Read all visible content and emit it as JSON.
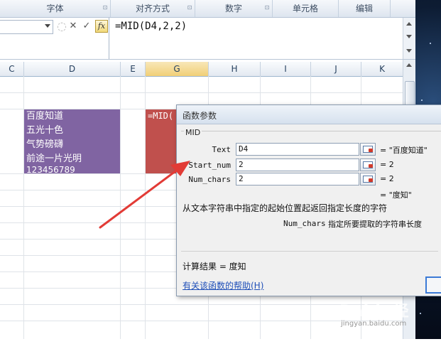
{
  "ribbon": {
    "groups": [
      {
        "label": "字体",
        "launcher": "⊡"
      },
      {
        "label": "对齐方式",
        "launcher": "⊡"
      },
      {
        "label": "数字",
        "launcher": "⊡"
      },
      {
        "label": "单元格"
      },
      {
        "label": "编辑"
      }
    ]
  },
  "formula_bar": {
    "cancel_symbol": "✕",
    "enter_symbol": "✓",
    "fx_label": "fx",
    "formula": "=MID(D4,2,2)"
  },
  "columns": [
    "C",
    "D",
    "E",
    "G",
    "H",
    "I",
    "J",
    "K"
  ],
  "cells": {
    "d4_lines": [
      "百度知道",
      "五光十色",
      "气势磅礴",
      "前途一片光明",
      "123456789"
    ],
    "g4_text": "=MID("
  },
  "dialog": {
    "title": "函数参数",
    "function_name": "MID",
    "args": [
      {
        "name": "Text",
        "value": "D4",
        "result": "= \"百度知道\""
      },
      {
        "name": "Start_num",
        "value": "2",
        "result": "= 2"
      },
      {
        "name": "Num_chars",
        "value": "2",
        "result": "= 2"
      }
    ],
    "overall_result": "= \"度知\"",
    "description": "从文本字符串中指定的起始位置起返回指定长度的字符",
    "arg_desc_name": "Num_chars",
    "arg_desc_text": "指定所要提取的字符串长度",
    "calc_result": "计算结果 =  度知",
    "help_link": "有关该函数的帮助(H)"
  },
  "watermark": {
    "text": "Baidu经验",
    "url": "jingyan.baidu.com"
  },
  "colors": {
    "purple_cell": "#8064a2",
    "red_cell": "#c0504d",
    "arrow": "#e23b36"
  }
}
